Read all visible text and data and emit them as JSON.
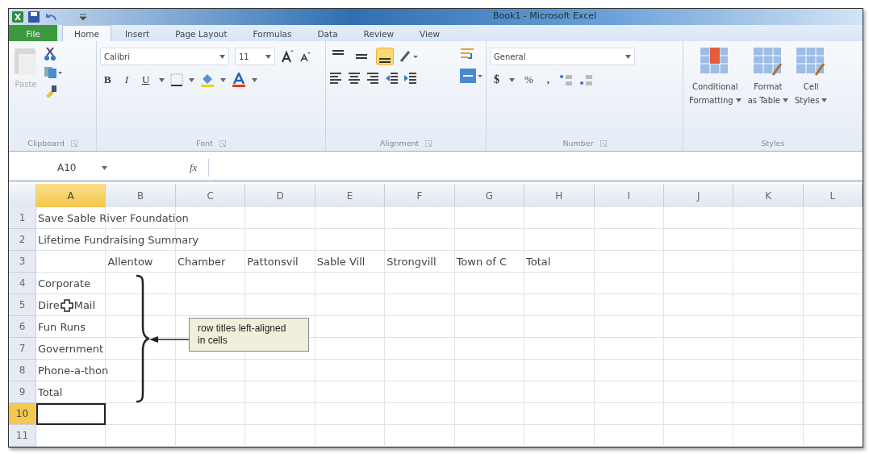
{
  "window": {
    "title": "Book1 - Microsoft Excel"
  },
  "tabs": [
    {
      "label": "File",
      "kind": "file",
      "selected": false
    },
    {
      "label": "Home",
      "kind": "tab",
      "selected": true
    },
    {
      "label": "Insert",
      "kind": "tab",
      "selected": false
    },
    {
      "label": "Page Layout",
      "kind": "tab",
      "selected": false
    },
    {
      "label": "Formulas",
      "kind": "tab",
      "selected": false
    },
    {
      "label": "Data",
      "kind": "tab",
      "selected": false
    },
    {
      "label": "Review",
      "kind": "tab",
      "selected": false
    },
    {
      "label": "View",
      "kind": "tab",
      "selected": false
    }
  ],
  "ribbon": {
    "clipboard": {
      "label": "Clipboard",
      "paste": "Paste",
      "paste_disabled": true
    },
    "font": {
      "label": "Font",
      "name": "Calibri",
      "size": "11",
      "bold": "B",
      "italic": "I",
      "underline": "U"
    },
    "alignment": {
      "label": "Alignment",
      "vertical_align": [
        {
          "selected": false
        },
        {
          "selected": false
        },
        {
          "selected": true
        }
      ]
    },
    "number": {
      "label": "Number",
      "format": "General",
      "currency": "$",
      "percent": "%",
      "comma": ","
    },
    "styles": {
      "label": "Styles",
      "buttons": [
        {
          "lines": [
            "Conditional",
            "Formatting"
          ]
        },
        {
          "lines": [
            "Format",
            "as Table"
          ]
        },
        {
          "lines": [
            "Cell",
            "Styles"
          ]
        }
      ]
    }
  },
  "formula_bar": {
    "name_box": "A10",
    "function_label": "fx"
  },
  "sheet": {
    "columns": [
      {
        "label": "A",
        "selected": true
      },
      {
        "label": "B",
        "selected": false
      },
      {
        "label": "C",
        "selected": false
      },
      {
        "label": "D",
        "selected": false
      },
      {
        "label": "E",
        "selected": false
      },
      {
        "label": "F",
        "selected": false
      },
      {
        "label": "G",
        "selected": false
      },
      {
        "label": "H",
        "selected": false
      },
      {
        "label": "I",
        "selected": false
      },
      {
        "label": "J",
        "selected": false
      },
      {
        "label": "K",
        "selected": false
      },
      {
        "label": "L",
        "selected": false
      }
    ],
    "rows": [
      {
        "number": "1",
        "selected": false,
        "cells": [
          {
            "kind": "spill",
            "text": "Save Sable River Foundation",
            "selected": false
          }
        ]
      },
      {
        "number": "2",
        "selected": false,
        "cells": [
          {
            "kind": "spill",
            "text": "Lifetime Fundraising Summary",
            "selected": false
          }
        ]
      },
      {
        "number": "3",
        "selected": false,
        "cells": [
          {
            "kind": "empty",
            "selected": false
          },
          {
            "kind": "clip",
            "text": "Allentow",
            "selected": false
          },
          {
            "kind": "clip",
            "text": "Chamber",
            "selected": false
          },
          {
            "kind": "clip",
            "text": "Pattonsvil",
            "selected": false
          },
          {
            "kind": "clip",
            "text": "Sable Vill",
            "selected": false
          },
          {
            "kind": "clip",
            "text": "Strongvill",
            "selected": false
          },
          {
            "kind": "clip",
            "text": "Town of C",
            "selected": false
          },
          {
            "kind": "clip",
            "text": "Total",
            "selected": false
          }
        ]
      },
      {
        "number": "4",
        "selected": false,
        "cells": [
          {
            "kind": "spill",
            "text": "Corporate",
            "selected": false
          }
        ]
      },
      {
        "number": "5",
        "selected": false,
        "cells": [
          {
            "kind": "cursor",
            "parts": [
              "Dire",
              "Mail"
            ],
            "selected": false
          }
        ]
      },
      {
        "number": "6",
        "selected": false,
        "cells": [
          {
            "kind": "spill",
            "text": "Fun Runs",
            "selected": false
          }
        ]
      },
      {
        "number": "7",
        "selected": false,
        "cells": [
          {
            "kind": "spill",
            "text": "Government",
            "selected": false
          }
        ]
      },
      {
        "number": "8",
        "selected": false,
        "cells": [
          {
            "kind": "spill",
            "text": "Phone-a-thon",
            "selected": false
          }
        ]
      },
      {
        "number": "9",
        "selected": false,
        "cells": [
          {
            "kind": "spill",
            "text": "Total",
            "selected": false
          }
        ]
      },
      {
        "number": "10",
        "selected": true,
        "cells": [
          {
            "kind": "empty",
            "selected": true
          }
        ]
      },
      {
        "number": "11",
        "selected": false,
        "cells": []
      }
    ]
  },
  "callout": {
    "text": "row titles left-aligned in cells"
  }
}
